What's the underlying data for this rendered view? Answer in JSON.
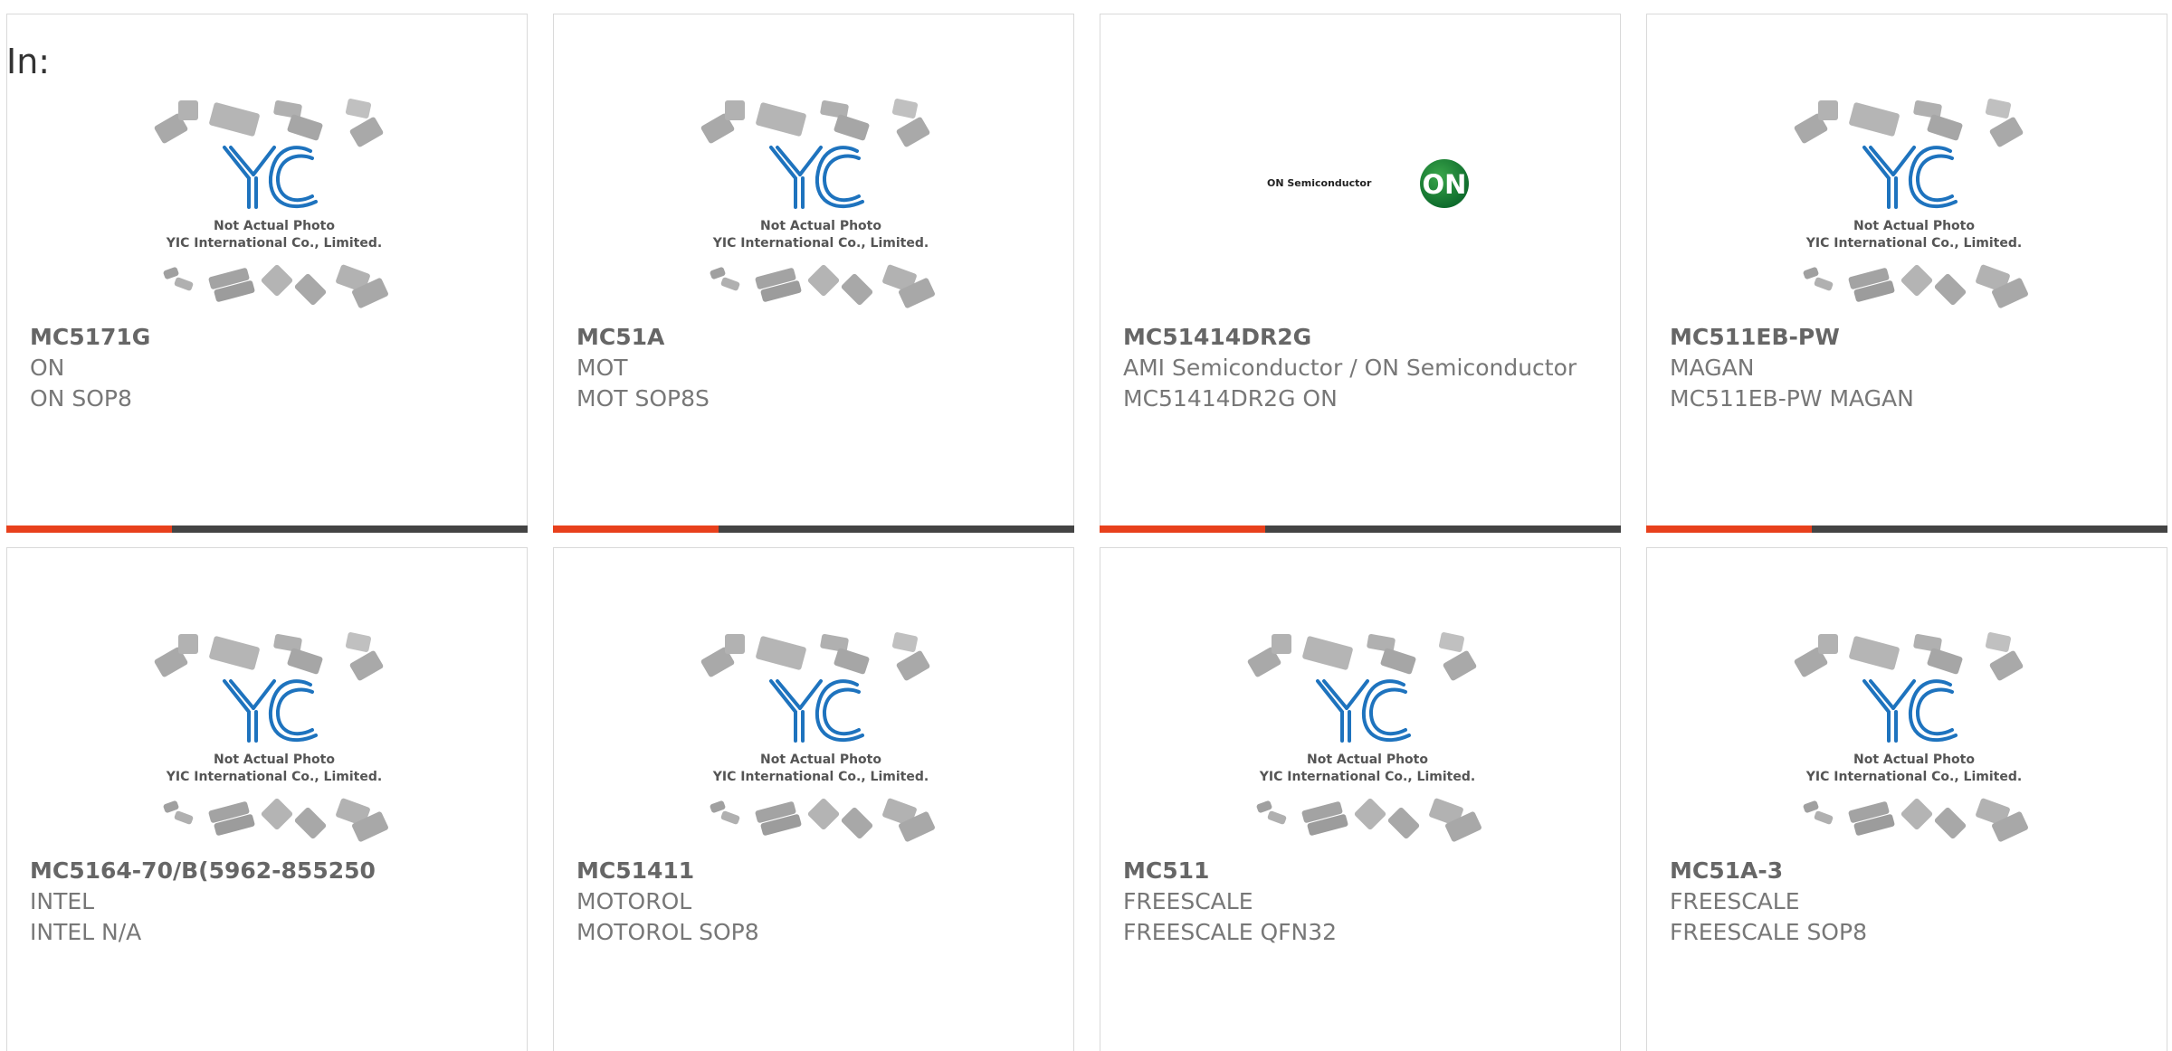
{
  "filter_label": "In:",
  "placeholder_text": {
    "line1": "Not Actual Photo",
    "line2": "YIC International Co., Limited."
  },
  "on_logo_text": "ON Semiconductor",
  "on_badge_text": "ON",
  "products": [
    {
      "part": "MC5171G",
      "maker": "ON",
      "package": "ON SOP8"
    },
    {
      "part": "MC51A",
      "maker": "MOT",
      "package": "MOT SOP8S"
    },
    {
      "part": "MC51414DR2G",
      "maker": "AMI Semiconductor / ON Semiconductor",
      "package": "MC51414DR2G ON"
    },
    {
      "part": "MC511EB-PW",
      "maker": "MAGAN",
      "package": "MC511EB-PW MAGAN"
    },
    {
      "part": "MC5164-70/B(5962-855250",
      "maker": "INTEL",
      "package": "INTEL N/A"
    },
    {
      "part": "MC51411",
      "maker": "MOTOROL",
      "package": "MOTOROL SOP8"
    },
    {
      "part": "MC511",
      "maker": "FREESCALE",
      "package": "FREESCALE QFN32"
    },
    {
      "part": "MC51A-3",
      "maker": "FREESCALE",
      "package": "FREESCALE SOP8"
    }
  ],
  "colors": {
    "accent": "#e8401c",
    "bar": "#444444",
    "logo_blue": "#1e73be"
  }
}
